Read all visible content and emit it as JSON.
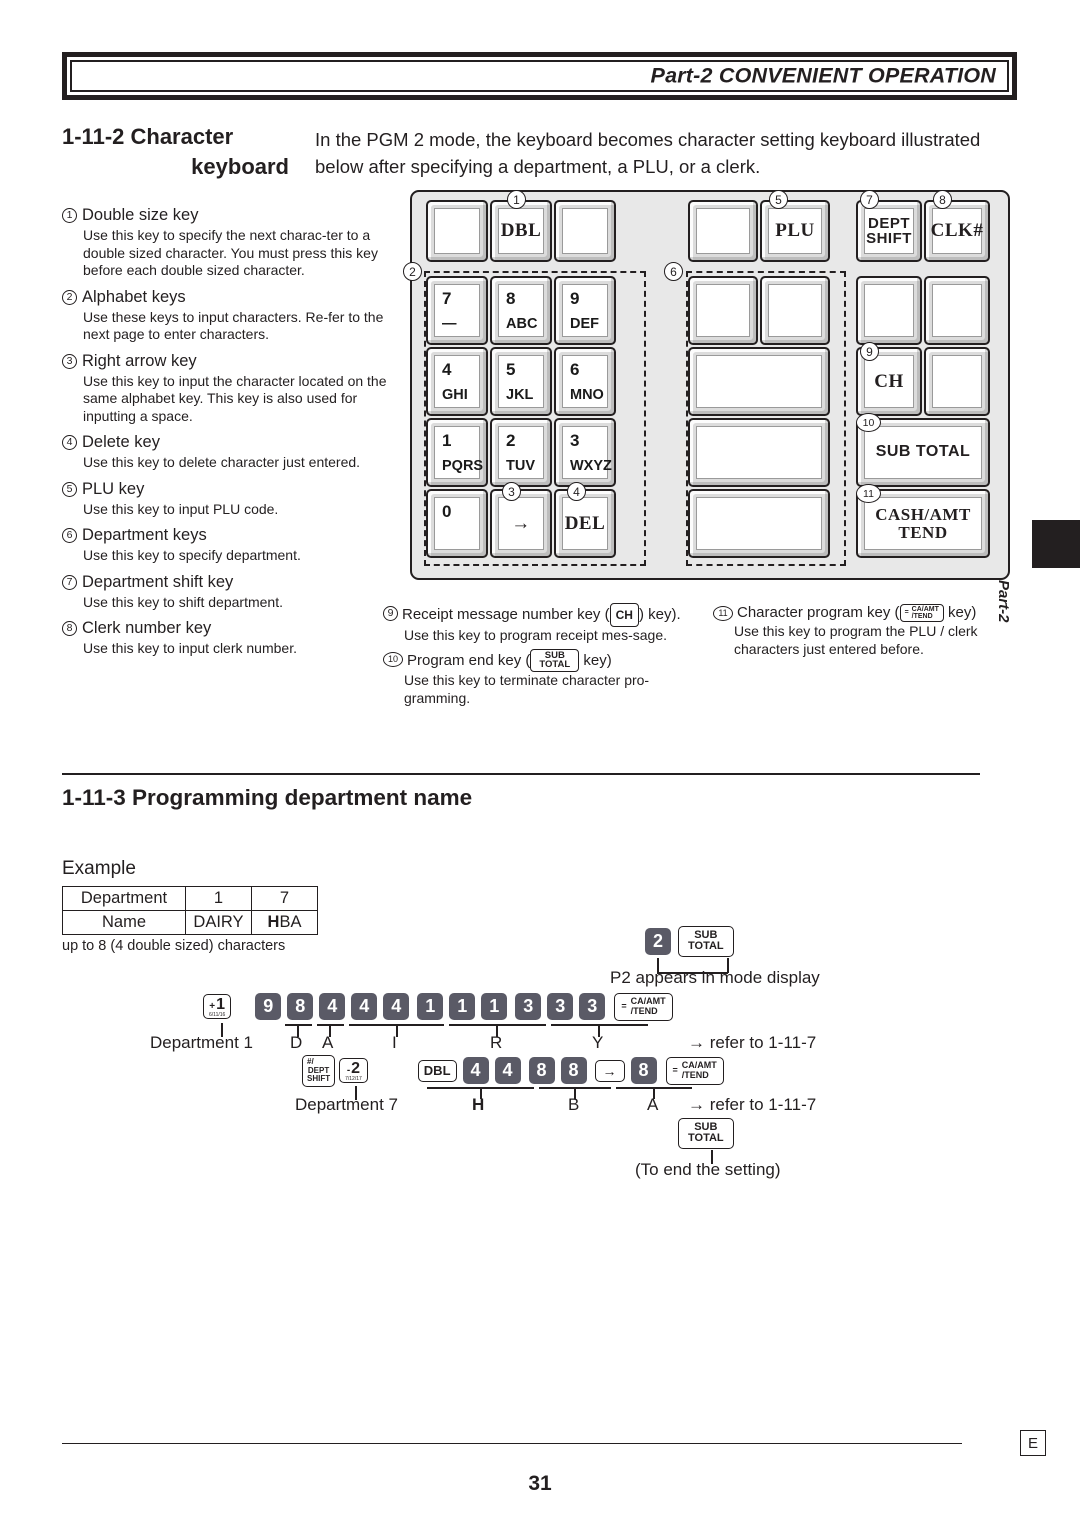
{
  "header": {
    "title": "Part-2 CONVENIENT OPERATION"
  },
  "section": {
    "number_line1": "1-11-2 Character",
    "number_line2": "keyboard",
    "intro": "In the PGM 2 mode, the keyboard becomes character setting keyboard illustrated below after specifying a department, a PLU, or a clerk."
  },
  "notes_left": [
    {
      "num": "1",
      "title": "Double size key",
      "body": "Use this key to specify the next charac-ter to a double sized character. You must press this key before each double sized character."
    },
    {
      "num": "2",
      "title": "Alphabet keys",
      "body": "Use these keys to input characters. Re-fer to the next page to enter characters."
    },
    {
      "num": "3",
      "title": "Right arrow key",
      "body": "Use this key to input the character located on the same alphabet key. This key is also used for inputting a space."
    },
    {
      "num": "4",
      "title": "Delete key",
      "body": "Use this key to delete character just entered."
    },
    {
      "num": "5",
      "title": "PLU key",
      "body": "Use this key to input PLU code."
    },
    {
      "num": "6",
      "title": "Department keys",
      "body": "Use this key to specify department."
    },
    {
      "num": "7",
      "title": "Department shift key",
      "body": "Use this key to shift department."
    },
    {
      "num": "8",
      "title": "Clerk number key",
      "body": "Use this key to input clerk number."
    }
  ],
  "notes_kb": {
    "n9": {
      "num": "9",
      "title_a": "Receipt message number key (",
      "key": "CH",
      "title_b": ") key).",
      "body": "Use this key to program receipt mes-sage."
    },
    "n10": {
      "num": "10",
      "title_a": "Program end key (",
      "key_l1": "SUB",
      "key_l2": "TOTAL",
      "title_b": " key)",
      "body": "Use this key to terminate character pro-gramming."
    },
    "n11": {
      "num": "11",
      "title_a": "Character program key (",
      "key_eq": "=",
      "key_l1": "CA/AMT",
      "key_l2": "/TEND",
      "title_b": " key)",
      "body": "Use this key to program the PLU / clerk characters just entered before."
    }
  },
  "keyboard": {
    "keys": {
      "dbl": "DBL",
      "plu": "PLU",
      "dept_shift_l1": "DEPT",
      "dept_shift_l2": "SHIFT",
      "clk": "CLK#",
      "ch": "CH",
      "sub_total": "SUB TOTAL",
      "cash_l1": "CASH/AMT",
      "cash_l2": "TEND",
      "arrow": "→",
      "del": "DEL"
    },
    "numpad": [
      {
        "num": "7",
        "letters": "—"
      },
      {
        "num": "8",
        "letters": "ABC"
      },
      {
        "num": "9",
        "letters": "DEF"
      },
      {
        "num": "4",
        "letters": "GHI"
      },
      {
        "num": "5",
        "letters": "JKL"
      },
      {
        "num": "6",
        "letters": "MNO"
      },
      {
        "num": "1",
        "letters": "PQRS"
      },
      {
        "num": "2",
        "letters": "TUV"
      },
      {
        "num": "3",
        "letters": "WXYZ"
      },
      {
        "num": "0",
        "letters": ""
      }
    ],
    "callouts": [
      "1",
      "2",
      "3",
      "4",
      "5",
      "6",
      "7",
      "8",
      "9",
      "10",
      "11"
    ]
  },
  "part_tab": {
    "label": "Part-2"
  },
  "section3": {
    "title": "1-11-3 Programming department name",
    "example_label": "Example",
    "table": {
      "row1": [
        "Department",
        "1",
        "7"
      ],
      "row2_label": "Name",
      "row2_v1": "DAIRY",
      "row2_v2_dbl": "H",
      "row2_v2_rest": "BA"
    },
    "table_note": "up to 8 (4 double sized) characters"
  },
  "sequence": {
    "mode": {
      "key_num": "2",
      "key_l1": "SUB",
      "key_l2": "TOTAL",
      "caption": "P2 appears in mode display"
    },
    "row1": {
      "dept_key": {
        "plus": "+",
        "num": "1",
        "sub": "6/11/16"
      },
      "dept_caption": "Department 1",
      "digits": [
        "9",
        "8",
        "4",
        "4",
        "4",
        "1",
        "1",
        "1",
        "3",
        "3",
        "3"
      ],
      "letters": [
        "D",
        "A",
        "I",
        "R",
        "Y"
      ],
      "end_key": {
        "eq": "=",
        "l1": "CA/AMT",
        "l2": "/TEND"
      },
      "refer": "→ refer to 1-11-7"
    },
    "row2": {
      "shift_key": {
        "l0": "#/",
        "l1": "DEPT",
        "l2": "SHIFT"
      },
      "dept_key": {
        "minus": "-",
        "num": "2",
        "sub": "7/12/17"
      },
      "dept_caption": "Department 7",
      "dbl_key": "DBL",
      "digits": [
        "4",
        "4",
        "8",
        "8"
      ],
      "arrow_key": "→",
      "last_digit": "8",
      "letters": [
        "H",
        "B",
        "A"
      ],
      "end_key": {
        "eq": "=",
        "l1": "CA/AMT",
        "l2": "/TEND"
      },
      "refer": "→ refer to 1-11-7"
    },
    "finish": {
      "key_l1": "SUB",
      "key_l2": "TOTAL",
      "caption": "(To end the setting)"
    }
  },
  "footer": {
    "marker": "E",
    "page": "31"
  }
}
